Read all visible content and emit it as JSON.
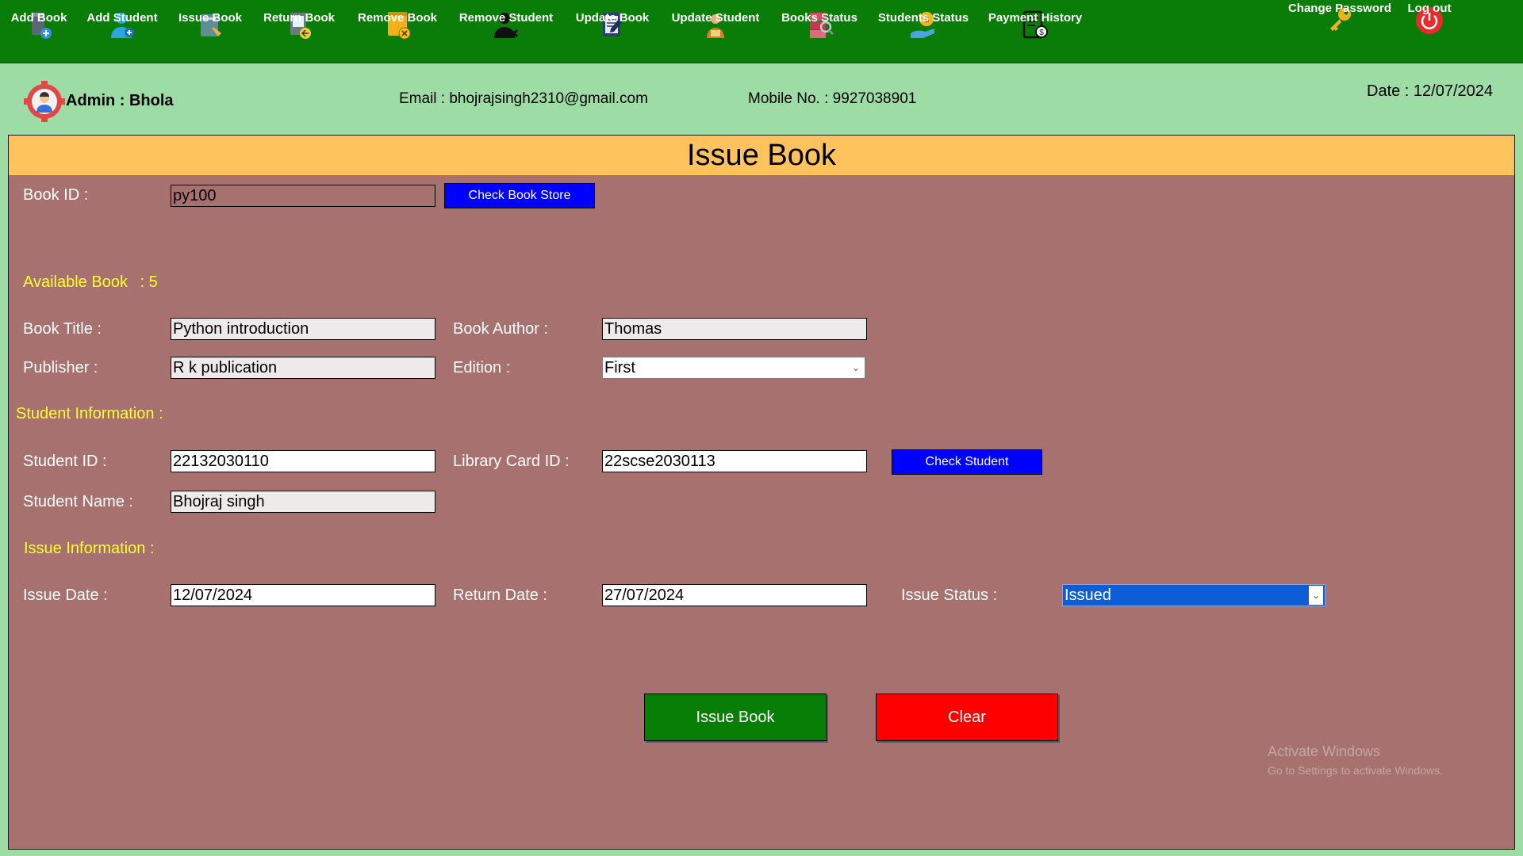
{
  "toolbar": {
    "items": [
      {
        "label": "Add Book",
        "icon": "add-book-icon"
      },
      {
        "label": "Add Student",
        "icon": "add-student-icon"
      },
      {
        "label": "Issue Book",
        "icon": "issue-book-icon"
      },
      {
        "label": "Return Book",
        "icon": "return-book-icon"
      },
      {
        "label": "Remove Book",
        "icon": "remove-book-icon"
      },
      {
        "label": "Remove Student",
        "icon": "remove-student-icon"
      },
      {
        "label": "Update Book",
        "icon": "update-book-icon"
      },
      {
        "label": "Update Student",
        "icon": "update-student-icon"
      },
      {
        "label": "Books Status",
        "icon": "books-status-icon"
      },
      {
        "label": "Students Status",
        "icon": "students-status-icon"
      },
      {
        "label": "Payment History",
        "icon": "payment-history-icon"
      }
    ],
    "right": [
      {
        "label": "Change Password",
        "icon": "key-icon"
      },
      {
        "label": "Log out",
        "icon": "power-icon"
      }
    ]
  },
  "info": {
    "admin": "Admin : Bhola",
    "email": "Email : bhojrajsingh2310@gmail.com",
    "mobile": "Mobile No. : 9927038901",
    "date": "Date : 12/07/2024"
  },
  "panel": {
    "title": "Issue Book",
    "book_id_label": "Book ID :",
    "book_id_value": "py100",
    "check_book_store": "Check Book Store",
    "available_label": "Available Book",
    "available_value": ": 5",
    "book_title_label": "Book Title :",
    "book_title_value": "Python introduction",
    "book_author_label": "Book Author :",
    "book_author_value": "Thomas",
    "publisher_label": "Publisher :",
    "publisher_value": "R k publication",
    "edition_label": "Edition :",
    "edition_value": "First",
    "student_section": "Student Information :",
    "student_id_label": "Student ID :",
    "student_id_value": "22132030110",
    "library_card_label": "Library Card ID :",
    "library_card_value": "22scse2030113",
    "check_student": "Check Student",
    "student_name_label": "Student Name :",
    "student_name_value": "Bhojraj singh",
    "issue_section": "Issue Information :",
    "issue_date_label": "Issue Date :",
    "issue_date_value": "12/07/2024",
    "return_date_label": "Return Date :",
    "return_date_value": "27/07/2024",
    "issue_status_label": "Issue Status :",
    "issue_status_value": "Issued",
    "issue_button": "Issue Book",
    "clear_button": "Clear"
  },
  "watermark": {
    "line1": "Activate Windows",
    "line2": "Go to Settings to activate Windows."
  },
  "colors": {
    "toolbar": "#0a7d08",
    "background": "#9ddca4",
    "panel": "#a77170",
    "title_bar": "#ffc35e",
    "section_text": "#ffff2b",
    "blue_button": "#0000ff",
    "issue_button": "#087e07",
    "clear_button": "#ff0000"
  }
}
